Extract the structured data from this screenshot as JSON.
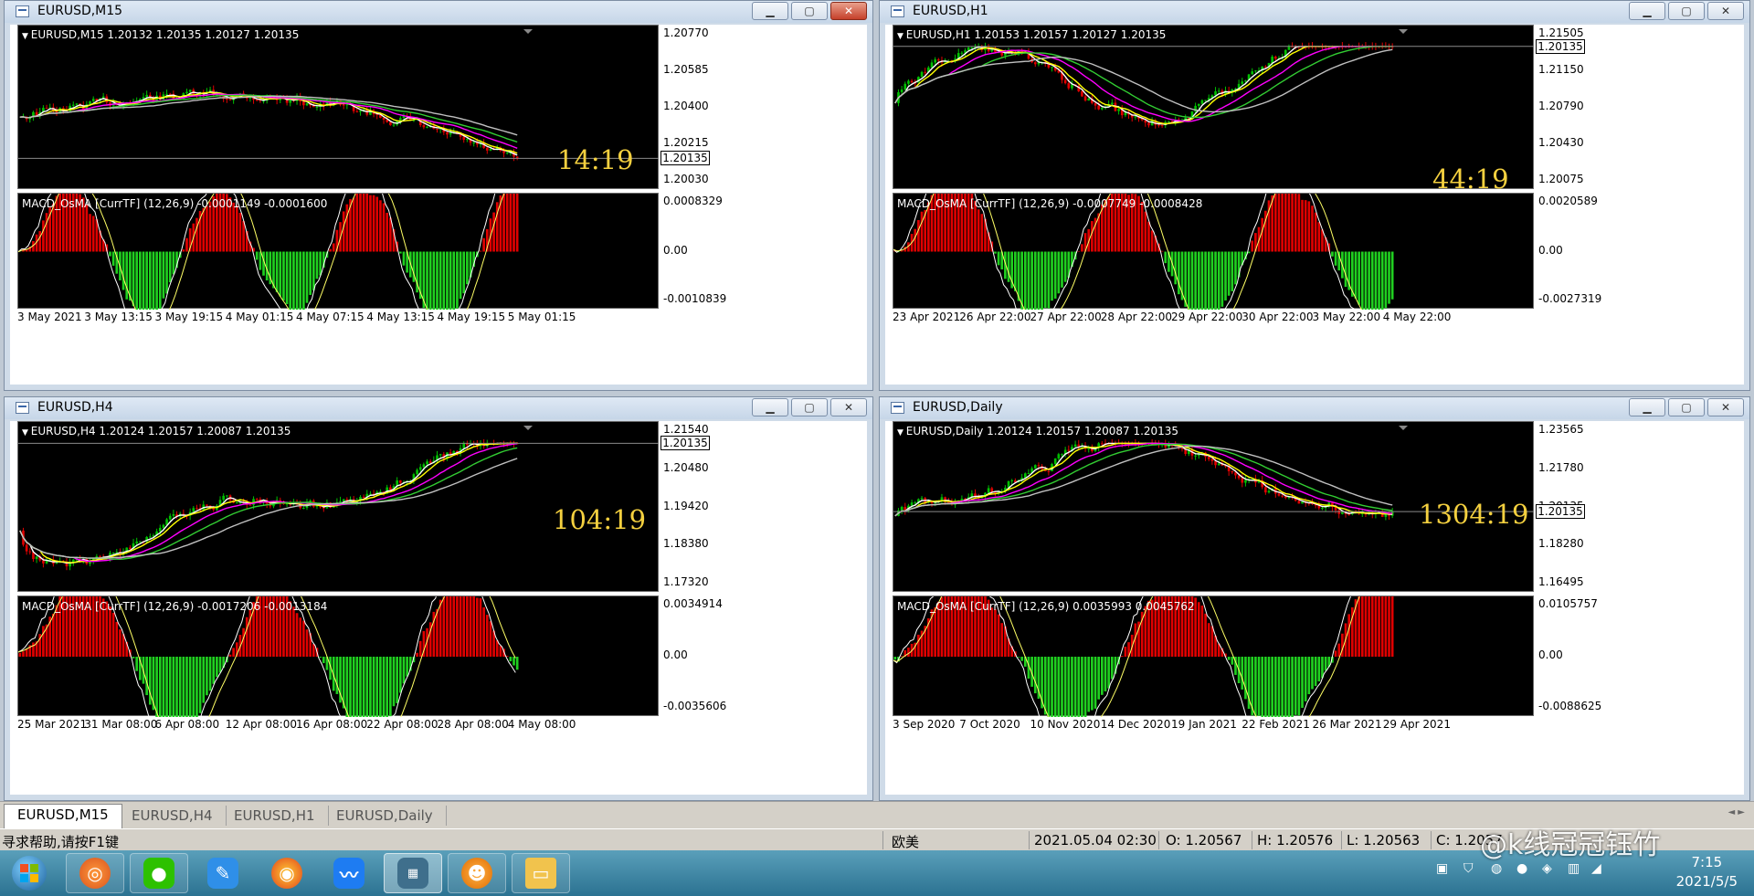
{
  "windows": [
    {
      "id": "m15",
      "title": "EURUSD,M15",
      "ohlc": "EURUSD,M15  1.20132 1.20135 1.20127 1.20135",
      "price_ticks": [
        "1.20770",
        "1.20585",
        "1.20400",
        "1.20215",
        "1.20030"
      ],
      "current_price": "1.20135",
      "countdown": "14:19",
      "macd_label": "MACD_OsMA [CurrTF] (12,26,9) -0.0001149 -0.0001600",
      "macd_ticks": [
        "0.0008329",
        "0.00",
        "-0.0010839"
      ],
      "time_labels": [
        "3 May 2021",
        "3 May 13:15",
        "3 May 19:15",
        "4 May 01:15",
        "4 May 07:15",
        "4 May 13:15",
        "4 May 19:15",
        "5 May 01:15"
      ]
    },
    {
      "id": "h1",
      "title": "EURUSD,H1",
      "ohlc": "EURUSD,H1  1.20153 1.20157 1.20127 1.20135",
      "price_ticks": [
        "1.21505",
        "1.21150",
        "1.20790",
        "1.20430",
        "1.20075"
      ],
      "current_price": "1.20135",
      "countdown": "44:19",
      "macd_label": "MACD_OsMA [CurrTF] (12,26,9) -0.0007749 -0.0008428",
      "macd_ticks": [
        "0.0020589",
        "0.00",
        "-0.0027319"
      ],
      "time_labels": [
        "23 Apr 2021",
        "26 Apr 22:00",
        "27 Apr 22:00",
        "28 Apr 22:00",
        "29 Apr 22:00",
        "30 Apr 22:00",
        "3 May 22:00",
        "4 May 22:00"
      ]
    },
    {
      "id": "h4",
      "title": "EURUSD,H4",
      "ohlc": "EURUSD,H4  1.20124 1.20157 1.20087 1.20135",
      "price_ticks": [
        "1.21540",
        "1.20480",
        "1.19420",
        "1.18380",
        "1.17320"
      ],
      "current_price": "1.20135",
      "countdown": "104:19",
      "macd_label": "MACD_OsMA [CurrTF] (12,26,9) -0.0017206 -0.0013184",
      "macd_ticks": [
        "0.0034914",
        "0.00",
        "-0.0035606"
      ],
      "time_labels": [
        "25 Mar 2021",
        "31 Mar 08:00",
        "6 Apr 08:00",
        "12 Apr 08:00",
        "16 Apr 08:00",
        "22 Apr 08:00",
        "28 Apr 08:00",
        "4 May 08:00"
      ]
    },
    {
      "id": "d1",
      "title": "EURUSD,Daily",
      "ohlc": "EURUSD,Daily  1.20124 1.20157 1.20087 1.20135",
      "price_ticks": [
        "1.23565",
        "1.21780",
        "1.20135",
        "1.18280",
        "1.16495"
      ],
      "current_price": "1.20135",
      "countdown": "1304:19",
      "macd_label": "MACD_OsMA [CurrTF] (12,26,9) 0.0035993 0.0045762",
      "macd_ticks": [
        "0.0105757",
        "0.00",
        "-0.0088625"
      ],
      "time_labels": [
        "3 Sep 2020",
        "7 Oct 2020",
        "10 Nov 2020",
        "14 Dec 2020",
        "19 Jan 2021",
        "22 Feb 2021",
        "26 Mar 2021",
        "29 Apr 2021"
      ]
    }
  ],
  "tabs": [
    "EURUSD,M15",
    "EURUSD,H4",
    "EURUSD,H1",
    "EURUSD,Daily"
  ],
  "status": {
    "help": "寻求帮助,请按F1键",
    "profile": "欧美",
    "datetime": "2021.05.04 02:30",
    "open": "O: 1.20567",
    "high": "H: 1.20576",
    "low": "L: 1.20563",
    "close": "C: 1.2057"
  },
  "watermark": "@k线冠冠钰竹",
  "clock": {
    "time": "7:15",
    "date": "2021/5/5"
  },
  "colors": {
    "bull": "#00c000",
    "bear": "#e00000",
    "ma_white": "#ffffff",
    "ma_yellow": "#ffff00",
    "ma_magenta": "#ff00ff",
    "ma_green": "#32cd32",
    "ma_gray": "#c0c0c0",
    "countdown": "#f4d03f"
  }
}
